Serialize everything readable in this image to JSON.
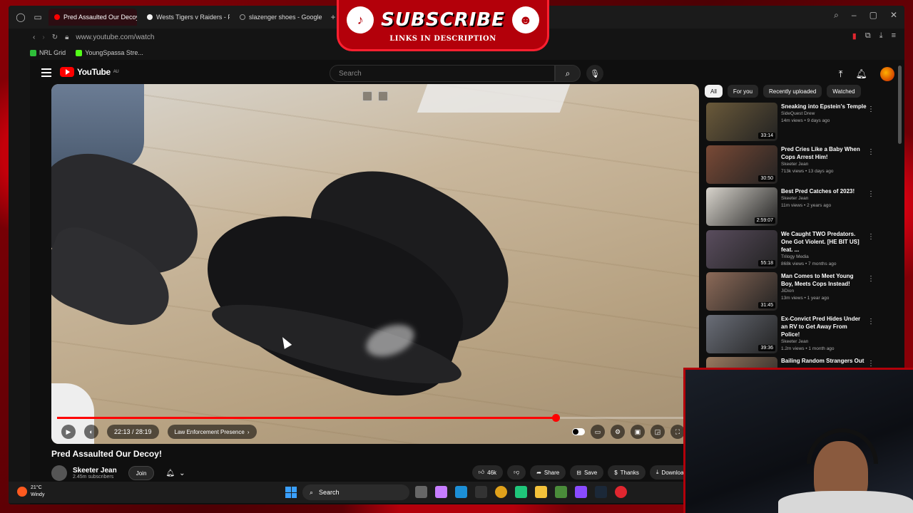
{
  "browser": {
    "tabs": [
      {
        "label": "Pred Assaulted Our Decoy",
        "active": true,
        "icon": "youtube-icon"
      },
      {
        "label": "Wests Tigers v Raiders - F",
        "active": false,
        "icon": "nrl-icon"
      },
      {
        "label": "slazenger shoes - Google",
        "active": false,
        "icon": "loading-icon"
      }
    ],
    "url": "www.youtube.com/watch",
    "bookmarks": [
      "NRL Grid",
      "YoungSpassa Stre..."
    ]
  },
  "overlay": {
    "banner_text": "SUBSCRIBE",
    "banner_sub": "LINKS IN DESCRIPTION"
  },
  "youtube": {
    "logo": "YouTube",
    "region": "AU",
    "search_placeholder": "Search"
  },
  "player": {
    "time": "22:13 / 28:19",
    "chapter": "Law Enforcement Presence",
    "progress": 0.784
  },
  "video": {
    "title": "Pred Assaulted Our Decoy!",
    "channel": "Skeeter Jean",
    "subscribers": "2.45m subscribers",
    "join_label": "Join",
    "likes": "46k",
    "share_label": "Share",
    "save_label": "Save",
    "thanks_label": "Thanks",
    "download_label": "Download"
  },
  "chips": [
    "All",
    "For you",
    "Recently uploaded",
    "Watched"
  ],
  "recommendations": [
    {
      "title": "Sneaking into Epstein's Temple",
      "channel": "SideQuest Drew",
      "meta": "14m views • 9 days ago",
      "duration": "33:14",
      "color": "#6b5a3a"
    },
    {
      "title": "Pred Cries Like a Baby When Cops Arrest Him!",
      "channel": "Skeeter Jean",
      "meta": "713k views • 13 days ago",
      "duration": "30:50",
      "color": "#7a4a36"
    },
    {
      "title": "Best Pred Catches of 2023!",
      "channel": "Skeeter Jean",
      "meta": "11m views • 2 years ago",
      "duration": "2:59:07",
      "color": "#d8d4cc"
    },
    {
      "title": "We Caught TWO Predators. One Got Violent. [HE BIT US] feat. ...",
      "channel": "Trilogy Media",
      "meta": "868k views • 7 months ago",
      "duration": "55:18",
      "color": "#5a4d5e"
    },
    {
      "title": "Man Comes to Meet Young Boy, Meets Cops Instead!",
      "channel": "JiDion",
      "meta": "13m views • 1 year ago",
      "duration": "31:45",
      "color": "#8c6a58"
    },
    {
      "title": "Ex-Convict Pred Hides Under an RV to Get Away From Police!",
      "channel": "Skeeter Jean",
      "meta": "1.2m views • 1 month ago",
      "duration": "39:36",
      "color": "#6a6e78"
    },
    {
      "title": "Bailing Random Strangers Out",
      "channel": "",
      "meta": "",
      "duration": "",
      "color": "#9a7a60"
    }
  ],
  "taskbar": {
    "temperature": "21°C",
    "weather": "Windy",
    "search_label": "Search"
  }
}
